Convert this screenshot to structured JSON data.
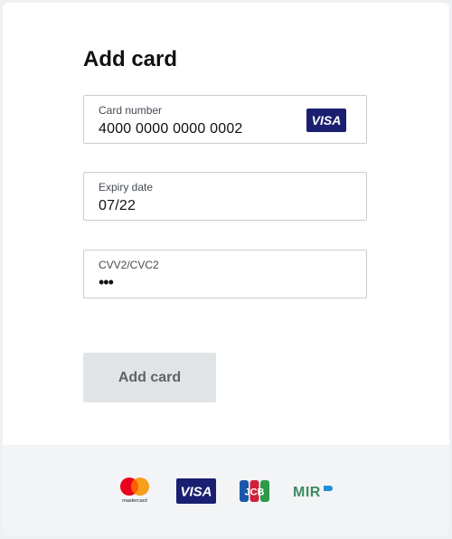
{
  "form": {
    "title": "Add card",
    "card_number": {
      "label": "Card number",
      "value": "4000 0000 0000 0002",
      "brand_icon": "visa-logo"
    },
    "expiry": {
      "label": "Expiry date",
      "value": "07/22"
    },
    "cvv": {
      "label": "CVV2/CVC2",
      "value": "•••"
    },
    "submit_label": "Add card"
  },
  "footer": {
    "logos": [
      {
        "icon": "mastercard-logo",
        "text": "mastercard"
      },
      {
        "icon": "visa-logo",
        "text": "VISA"
      },
      {
        "icon": "jcb-logo",
        "text": "JCB"
      },
      {
        "icon": "mir-logo",
        "text": "MIR"
      }
    ]
  },
  "colors": {
    "visa_navy": "#1a1f71",
    "button_bg": "#e1e4e7",
    "button_text": "#5d6369",
    "footer_bg": "#f3f4f6",
    "mir_green": "#3d8b62"
  }
}
